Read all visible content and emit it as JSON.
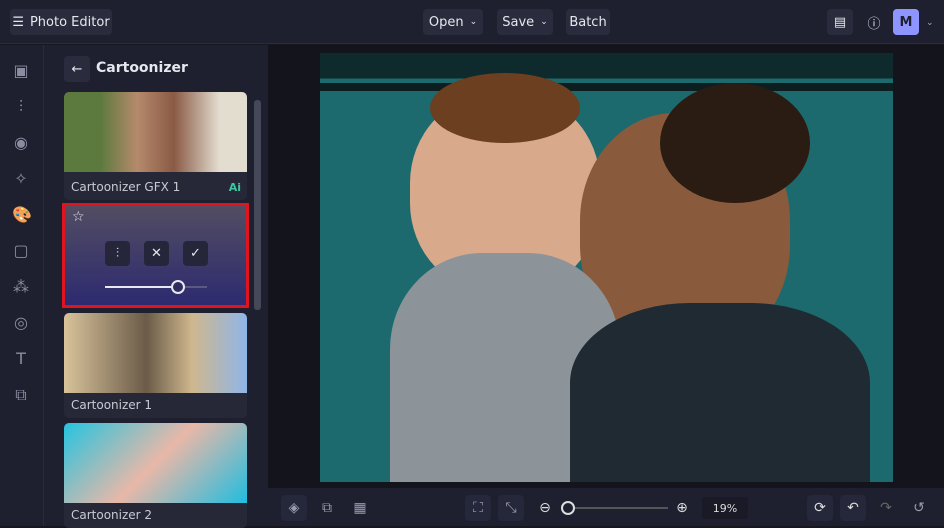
{
  "header": {
    "app_title": "Photo Editor",
    "open_label": "Open",
    "save_label": "Save",
    "batch_label": "Batch",
    "avatar_initial": "M"
  },
  "panel": {
    "title": "Cartoonizer",
    "items": [
      {
        "label": "Cartoonizer GFX 1",
        "badge": "Ai"
      },
      {
        "label": "Cartoonizer 1"
      },
      {
        "label": "Cartoonizer 2"
      }
    ],
    "selected_slider_value": 0.72
  },
  "bottom": {
    "zoom_value": "19%",
    "zoom_slider": 0.0
  },
  "colors": {
    "accent": "#8f95ff",
    "selection": "#e0141e",
    "ai_badge": "#3cc7a0"
  }
}
